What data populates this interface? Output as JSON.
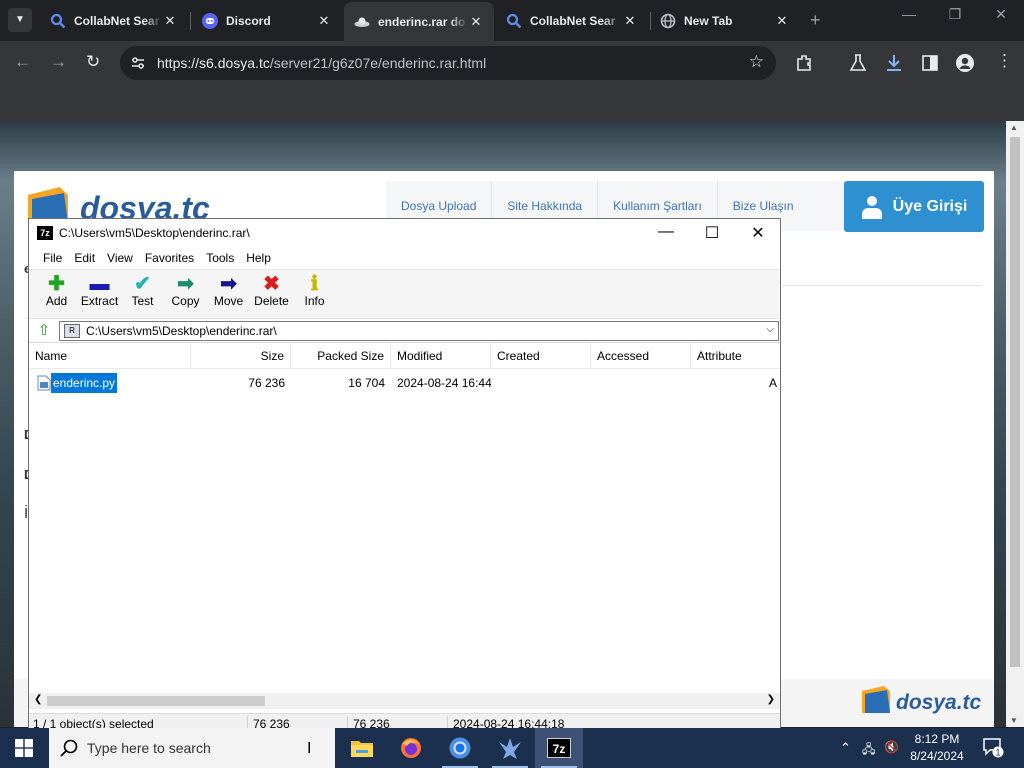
{
  "browser": {
    "tabs": [
      {
        "title": "CollabNet Sear",
        "icon": "search-icon"
      },
      {
        "title": "Discord",
        "icon": "discord-icon"
      },
      {
        "title": "enderinc.rar do",
        "icon": "dosya-favicon",
        "active": true
      },
      {
        "title": "CollabNet Sear",
        "icon": "search-icon"
      },
      {
        "title": "New Tab",
        "icon": "globe-icon"
      }
    ],
    "close_glyph": "✕",
    "url_host": "https://s6.dosya.tc",
    "url_path": "/server21/g6z07e/enderinc.rar.html"
  },
  "webpage": {
    "logo_text": "dosya.tc",
    "nav": [
      "Dosya Upload",
      "Site Hakkında",
      "Kullanım Şartları",
      "Bize Ulaşın"
    ],
    "login_button": "Üye Girişi",
    "partial_text": [
      "e",
      "D",
      "D",
      "İ"
    ]
  },
  "sevenzip": {
    "title": "C:\\Users\\vm5\\Desktop\\enderinc.rar\\",
    "app_icon": "7z",
    "menu": [
      "File",
      "Edit",
      "View",
      "Favorites",
      "Tools",
      "Help"
    ],
    "tools": [
      {
        "label": "Add",
        "glyph": "✚",
        "color": "#1fa81f"
      },
      {
        "label": "Extract",
        "glyph": "▬",
        "color": "#1c1cb0"
      },
      {
        "label": "Test",
        "glyph": "✔",
        "color": "#22b3b3"
      },
      {
        "label": "Copy",
        "glyph": "➡",
        "color": "#1b8f6c"
      },
      {
        "label": "Move",
        "glyph": "➡",
        "color": "#151590"
      },
      {
        "label": "Delete",
        "glyph": "✖",
        "color": "#d81f1f"
      },
      {
        "label": "Info",
        "glyph": "ℹ",
        "color": "#c8b400"
      }
    ],
    "address": "C:\\Users\\vm5\\Desktop\\enderinc.rar\\",
    "columns": [
      "Name",
      "Size",
      "Packed Size",
      "Modified",
      "Created",
      "Accessed",
      "Attribute"
    ],
    "rows": [
      {
        "name": "enderinc.py",
        "size": "76 236",
        "packed": "16 704",
        "modified": "2024-08-24 16:44",
        "created": "",
        "accessed": "",
        "attr": "A"
      }
    ],
    "status": {
      "selected": "1 / 1 object(s) selected",
      "size": "76 236",
      "packed": "76 236",
      "modified": "2024-08-24 16:44:18"
    }
  },
  "taskbar": {
    "search_placeholder": "Type here to search",
    "time": "8:12 PM",
    "date": "8/24/2024",
    "notification_count": "1",
    "apps": [
      "file-explorer-icon",
      "firefox-icon",
      "chrome-icon",
      "bird-app-icon",
      "sevenzip-icon"
    ]
  }
}
